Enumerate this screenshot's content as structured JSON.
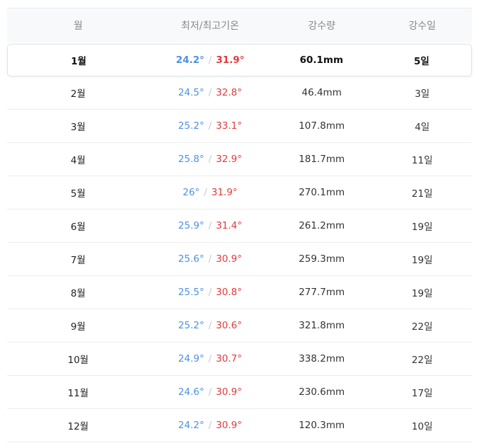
{
  "header": {
    "month": "월",
    "temp": "최저/최고기온",
    "precip": "강수량",
    "rain_days": "강수일"
  },
  "separator": "/",
  "rows": [
    {
      "month": "1월",
      "low": "24.2°",
      "high": "31.9°",
      "precip": "60.1mm",
      "days": "5일"
    },
    {
      "month": "2월",
      "low": "24.5°",
      "high": "32.8°",
      "precip": "46.4mm",
      "days": "3일"
    },
    {
      "month": "3월",
      "low": "25.2°",
      "high": "33.1°",
      "precip": "107.8mm",
      "days": "4일"
    },
    {
      "month": "4월",
      "low": "25.8°",
      "high": "32.9°",
      "precip": "181.7mm",
      "days": "11일"
    },
    {
      "month": "5월",
      "low": "26°",
      "high": "31.9°",
      "precip": "270.1mm",
      "days": "21일"
    },
    {
      "month": "6월",
      "low": "25.9°",
      "high": "31.4°",
      "precip": "261.2mm",
      "days": "19일"
    },
    {
      "month": "7월",
      "low": "25.6°",
      "high": "30.9°",
      "precip": "259.3mm",
      "days": "19일"
    },
    {
      "month": "8월",
      "low": "25.5°",
      "high": "30.8°",
      "precip": "277.7mm",
      "days": "19일"
    },
    {
      "month": "9월",
      "low": "25.2°",
      "high": "30.6°",
      "precip": "321.8mm",
      "days": "22일"
    },
    {
      "month": "10월",
      "low": "24.9°",
      "high": "30.7°",
      "precip": "338.2mm",
      "days": "22일"
    },
    {
      "month": "11월",
      "low": "24.6°",
      "high": "30.9°",
      "precip": "230.6mm",
      "days": "17일"
    },
    {
      "month": "12월",
      "low": "24.2°",
      "high": "30.9°",
      "precip": "120.3mm",
      "days": "10일"
    }
  ],
  "colors": {
    "low_temp": "#4d90e8",
    "high_temp": "#e23a3a"
  }
}
